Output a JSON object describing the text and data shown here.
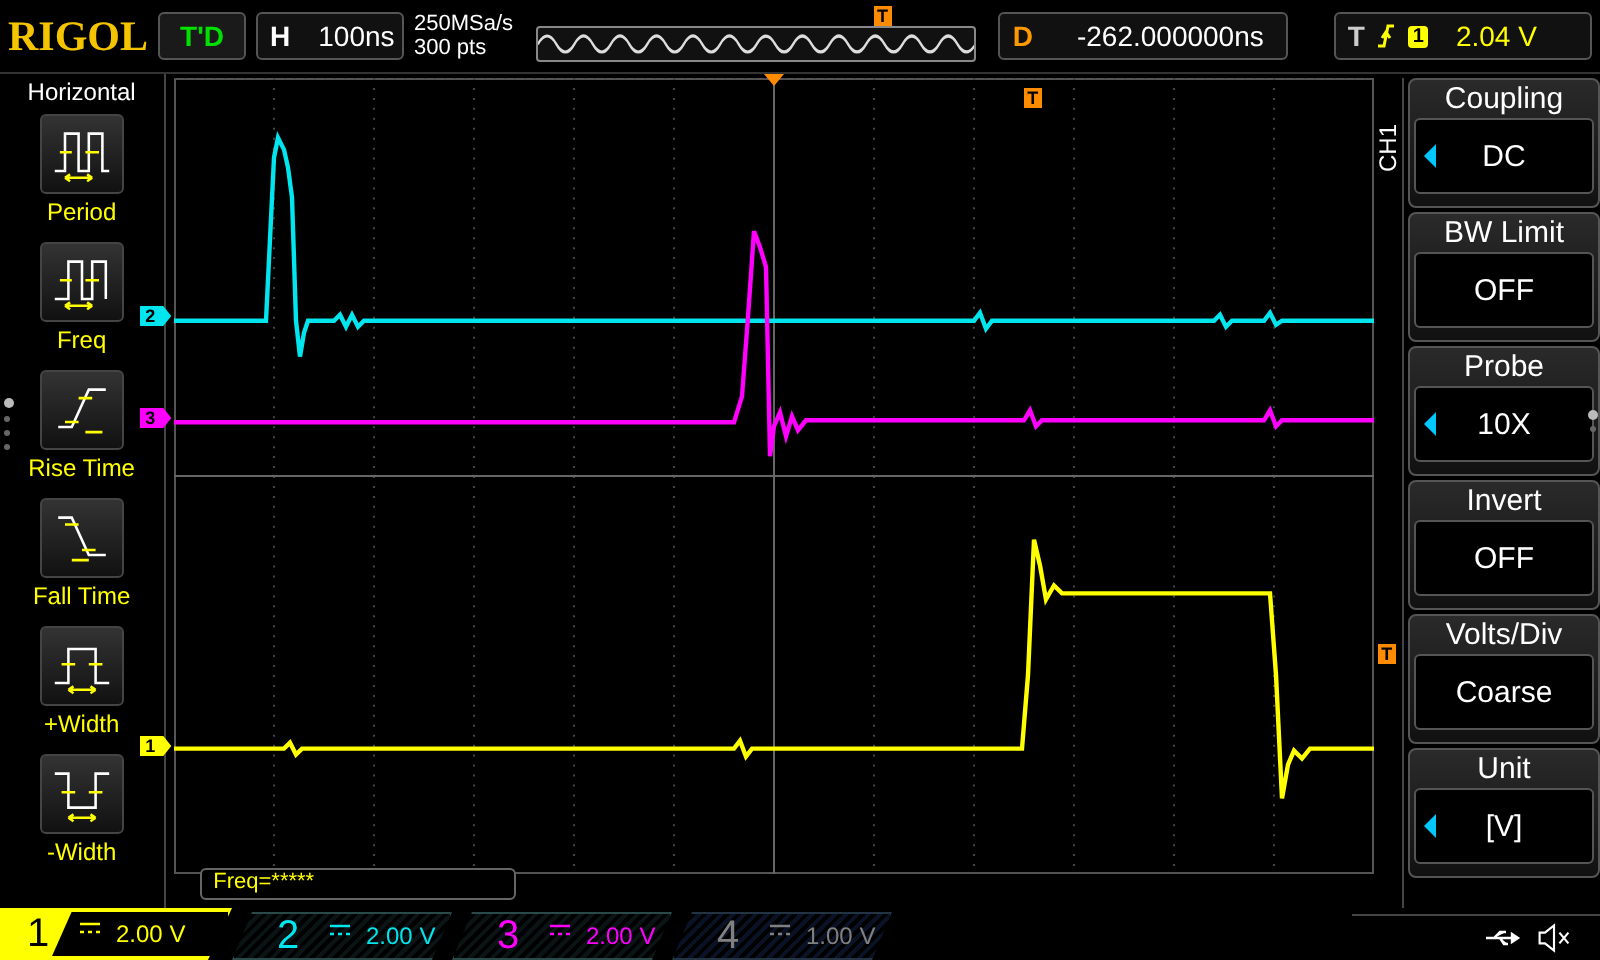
{
  "header": {
    "logo": "RIGOL",
    "status": "T'D",
    "timebase_label": "H",
    "timebase": "100ns",
    "sample_rate": "250MSa/s",
    "memory_depth": "300 pts",
    "timeline_marker": "T",
    "delay_label": "D",
    "delay": "-262.000000ns",
    "trigger_label": "T",
    "trigger_source": "1",
    "trigger_level": "2.04 V"
  },
  "measure_menu": {
    "title": "Horizontal",
    "items": [
      {
        "label": "Period",
        "kind": "period"
      },
      {
        "label": "Freq",
        "kind": "freq"
      },
      {
        "label": "Rise Time",
        "kind": "rise"
      },
      {
        "label": "Fall Time",
        "kind": "fall"
      },
      {
        "label": "+Width",
        "kind": "pwidth"
      },
      {
        "label": "-Width",
        "kind": "nwidth"
      }
    ]
  },
  "display": {
    "top_trigger_marker": "T",
    "side_trigger_marker": "T",
    "channel_markers": [
      {
        "label": "2",
        "color": "#00e5ee",
        "kind": "ch2"
      },
      {
        "label": "3",
        "color": "#ff00ff",
        "kind": "ch3"
      },
      {
        "label": "1",
        "color": "#ffff00",
        "kind": "ch1"
      }
    ],
    "freq_readout": "Freq=*****"
  },
  "channel_menu": {
    "channel": "CH1",
    "items": [
      {
        "title": "Coupling",
        "value": "DC",
        "adjustable": true
      },
      {
        "title": "BW Limit",
        "value": "OFF",
        "adjustable": false
      },
      {
        "title": "Probe",
        "value": "10X",
        "adjustable": true
      },
      {
        "title": "Invert",
        "value": "OFF",
        "adjustable": false
      },
      {
        "title": "Volts/Div",
        "value": "Coarse",
        "adjustable": false
      },
      {
        "title": "Unit",
        "value": "[V]",
        "adjustable": true
      }
    ]
  },
  "channels": [
    {
      "label": "1",
      "scale": "2.00 V",
      "on": true,
      "selected": true,
      "color": "#ffff00"
    },
    {
      "label": "2",
      "scale": "2.00 V",
      "on": true,
      "selected": false,
      "color": "#00e5ee"
    },
    {
      "label": "3",
      "scale": "2.00 V",
      "on": true,
      "selected": false,
      "color": "#ff00ff"
    },
    {
      "label": "4",
      "scale": "1.00 V",
      "on": false,
      "selected": false,
      "color": "#808080"
    }
  ]
}
